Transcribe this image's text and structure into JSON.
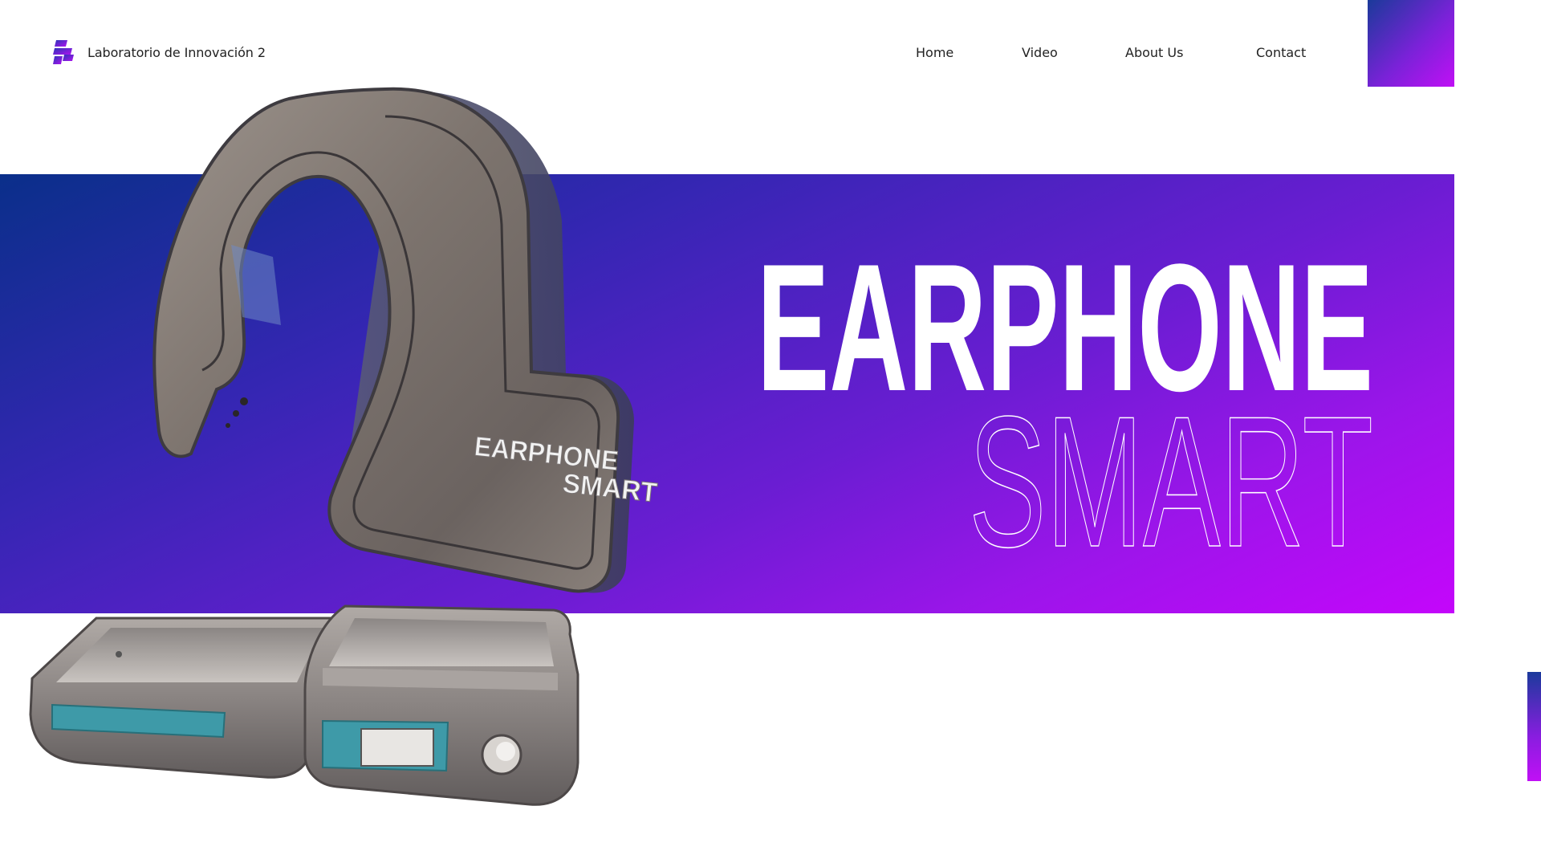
{
  "header": {
    "brand": "Laboratorio de Innovación 2",
    "nav": {
      "home": "Home",
      "video": "Video",
      "about": "About Us",
      "contact": "Contact"
    }
  },
  "hero": {
    "title_line1": "EARPHONE",
    "title_line2": "SMART"
  },
  "product": {
    "engraving_line1": "EARPHONE",
    "engraving_line2": "SMART"
  },
  "colors": {
    "gradient_start": "#0a2f8a",
    "gradient_end": "#c406fb",
    "text": "#222222"
  }
}
